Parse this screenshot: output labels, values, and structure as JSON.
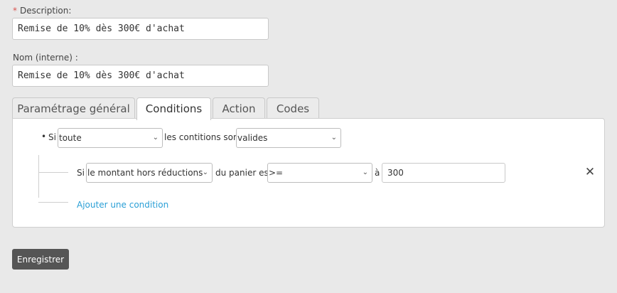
{
  "description": {
    "required_mark": "*",
    "label": "Description:",
    "value": "Remise de 10% dès 300€ d'achat"
  },
  "name_internal": {
    "label": "Nom (interne) :",
    "value": "Remise de 10% dès 300€ d'achat"
  },
  "tabs": [
    {
      "label": "Paramétrage général",
      "active": false
    },
    {
      "label": "Conditions",
      "active": true
    },
    {
      "label": "Action",
      "active": false
    },
    {
      "label": "Codes",
      "active": false
    }
  ],
  "conditions": {
    "root": {
      "bullet": "•",
      "prefix": "Si",
      "quantifier": "toute",
      "middle_text": "les contitions sont",
      "state": "valides"
    },
    "rule": {
      "prefix": "Si",
      "attribute": "le montant hors réductions",
      "middle_text": "du panier est",
      "operator": ">=",
      "joiner": "à",
      "value": "300",
      "remove_glyph": "✕"
    },
    "add_link": "Ajouter une condition"
  },
  "save_button": "Enregistrer",
  "icons": {
    "dropdown": "chevron-down-icon",
    "remove": "close-icon"
  }
}
